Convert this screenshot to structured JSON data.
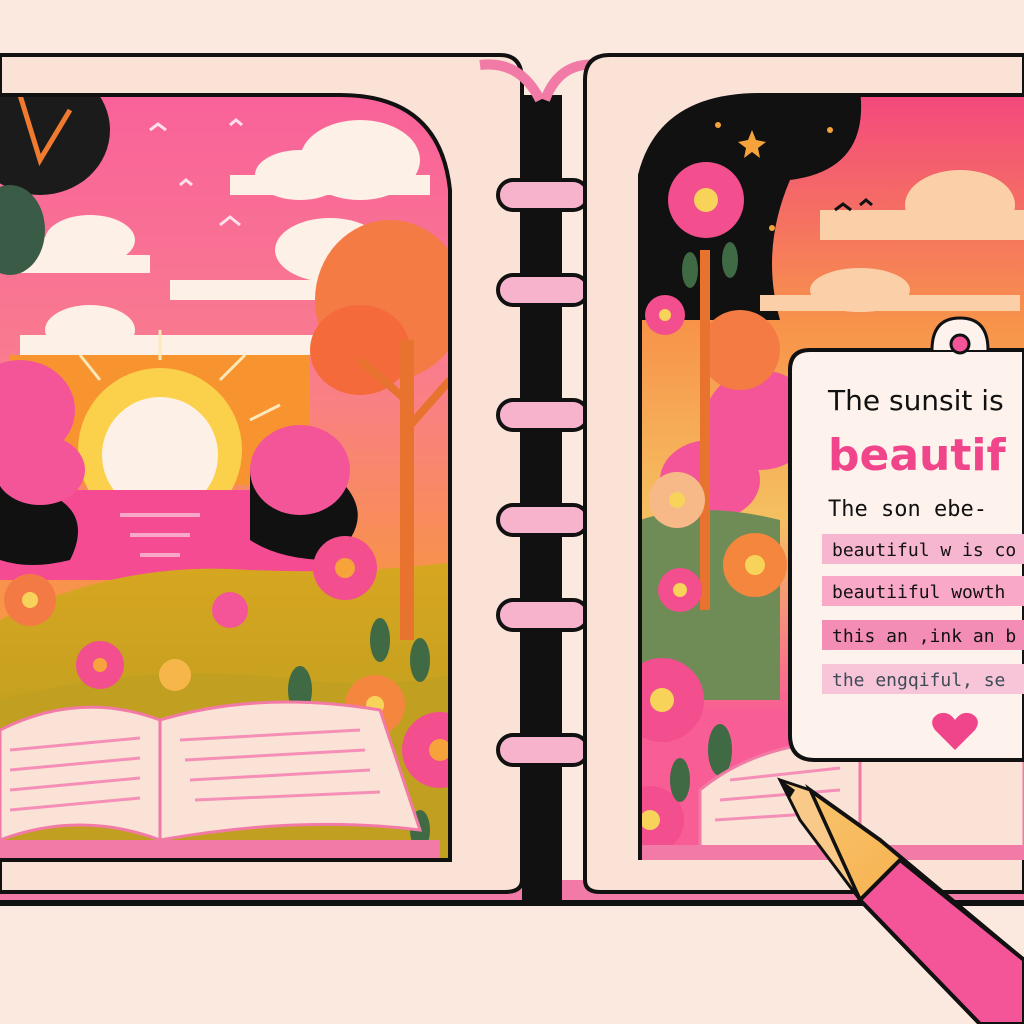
{
  "card": {
    "line1": "The sunsit is",
    "line2": "beautif",
    "line3": "The son ebe-",
    "highlights": [
      "beautiful w is co",
      "beautiiful wowth",
      "this an ,ink an b",
      "the engqiful, se"
    ]
  },
  "colors": {
    "background": "#fbe9df",
    "accent_pink": "#f0458a",
    "dark": "#111111",
    "orange": "#f4933a",
    "heart": "#f0458a",
    "highlight_1": "#f7b6cf",
    "highlight_2": "#f9a8c8",
    "highlight_3": "#f38db6",
    "highlight_4": "#f7c4d8"
  },
  "icons": [
    "heart-icon",
    "pencil-icon",
    "flower-icon",
    "sun-icon",
    "bird-icon",
    "star-icon",
    "ring-binding-icon"
  ]
}
